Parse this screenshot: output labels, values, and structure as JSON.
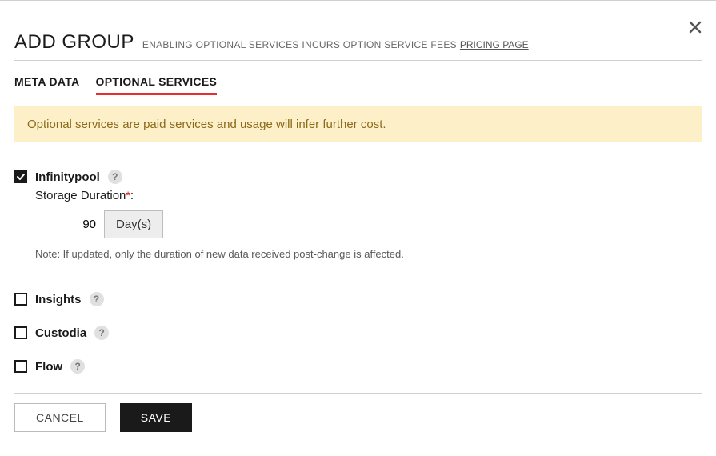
{
  "header": {
    "title": "ADD GROUP",
    "subtitle": "ENABLING OPTIONAL SERVICES INCURS OPTION SERVICE FEES",
    "pricing_link": "PRICING PAGE"
  },
  "tabs": {
    "meta_data": "META DATA",
    "optional_services": "OPTIONAL SERVICES"
  },
  "banner": {
    "message": "Optional services are paid services and usage will infer further cost."
  },
  "services": {
    "infinitypool": {
      "label": "Infinitypool",
      "checked": true,
      "storage_label": "Storage Duration",
      "storage_value": "90",
      "unit": "Day(s)",
      "note": "Note: If updated, only the duration of new data received post-change is affected."
    },
    "insights": {
      "label": "Insights",
      "checked": false
    },
    "custodia": {
      "label": "Custodia",
      "checked": false
    },
    "flow": {
      "label": "Flow",
      "checked": false
    }
  },
  "footer": {
    "cancel": "CANCEL",
    "save": "SAVE"
  },
  "icons": {
    "help": "?"
  }
}
